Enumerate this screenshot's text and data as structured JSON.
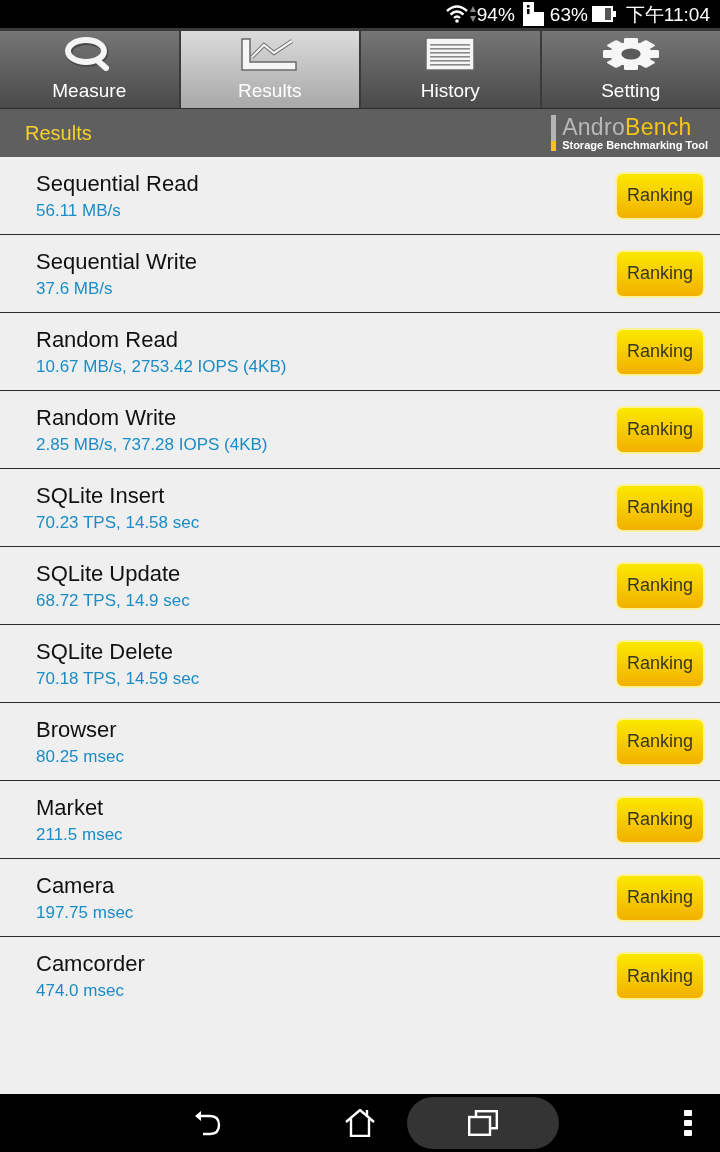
{
  "status_bar": {
    "wifi_percent": "94%",
    "battery_percent": "63%",
    "time": "下午11:04"
  },
  "tabs": [
    {
      "label": "Measure",
      "selected": false
    },
    {
      "label": "Results",
      "selected": true
    },
    {
      "label": "History",
      "selected": false
    },
    {
      "label": "Setting",
      "selected": false
    }
  ],
  "header": {
    "title": "Results",
    "logo": {
      "name_start": "Andro",
      "name_end": "Bench",
      "tagline": "Storage Benchmarking Tool"
    }
  },
  "results": [
    {
      "name": "Sequential Read",
      "value": "56.11 MB/s",
      "button": "Ranking"
    },
    {
      "name": "Sequential Write",
      "value": "37.6 MB/s",
      "button": "Ranking"
    },
    {
      "name": "Random Read",
      "value": "10.67 MB/s, 2753.42 IOPS (4KB)",
      "button": "Ranking"
    },
    {
      "name": "Random Write",
      "value": "2.85 MB/s, 737.28 IOPS (4KB)",
      "button": "Ranking"
    },
    {
      "name": "SQLite Insert",
      "value": "70.23 TPS, 14.58 sec",
      "button": "Ranking"
    },
    {
      "name": "SQLite Update",
      "value": "68.72 TPS, 14.9 sec",
      "button": "Ranking"
    },
    {
      "name": "SQLite Delete",
      "value": "70.18 TPS, 14.59 sec",
      "button": "Ranking"
    },
    {
      "name": "Browser",
      "value": "80.25 msec",
      "button": "Ranking"
    },
    {
      "name": "Market",
      "value": "211.5 msec",
      "button": "Ranking"
    },
    {
      "name": "Camera",
      "value": "197.75 msec",
      "button": "Ranking"
    },
    {
      "name": "Camcorder",
      "value": "474.0 msec",
      "button": "Ranking"
    }
  ]
}
